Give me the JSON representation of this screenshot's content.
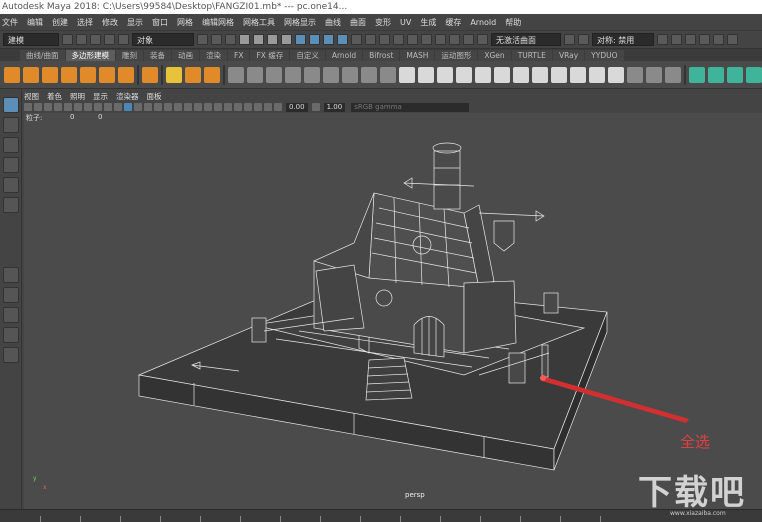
{
  "window": {
    "title": "Autodesk Maya 2018: C:\\Users\\99584\\Desktop\\FANGZI01.mb*  ---  pc.one14..."
  },
  "menubar": [
    "文件",
    "编辑",
    "创建",
    "选择",
    "修改",
    "显示",
    "窗口",
    "网格",
    "编辑网格",
    "网格工具",
    "网格显示",
    "曲线",
    "曲面",
    "变形",
    "UV",
    "生成",
    "缓存",
    "Arnold",
    "帮助"
  ],
  "statusline": {
    "mode": "建模",
    "object_mode": "对象",
    "live_surface": "无激活曲面",
    "symmetry": "对称: 禁用"
  },
  "shelf_tabs": [
    "曲线/曲面",
    "多边形建模",
    "雕刻",
    "装备",
    "动画",
    "渲染",
    "FX",
    "FX 缓存",
    "自定义",
    "Arnold",
    "Bifrost",
    "MASH",
    "运动图形",
    "XGen",
    "TURTLE",
    "VRay",
    "YYDUO"
  ],
  "active_shelf_tab": "多边形建模",
  "panel_menu": [
    "视图",
    "着色",
    "照明",
    "显示",
    "渲染器",
    "面板"
  ],
  "panel_fields": {
    "exposure": "0.00",
    "gamma": "1.00",
    "color_space": "sRGB gamma"
  },
  "hud": {
    "label": "粒子:",
    "v1": "0",
    "v2": "0"
  },
  "viewport": {
    "camera": "persp"
  },
  "axes": {
    "y": "y",
    "x": "x"
  },
  "annotation": {
    "text": "全选",
    "color": "#e14040"
  },
  "watermark": {
    "text": "下载吧",
    "sub": "www.xiazaiba.com"
  },
  "colors": {
    "accent": "#5b8fb8",
    "shelf_orange": "#e08a2a",
    "shelf_teal": "#3fb49a"
  }
}
